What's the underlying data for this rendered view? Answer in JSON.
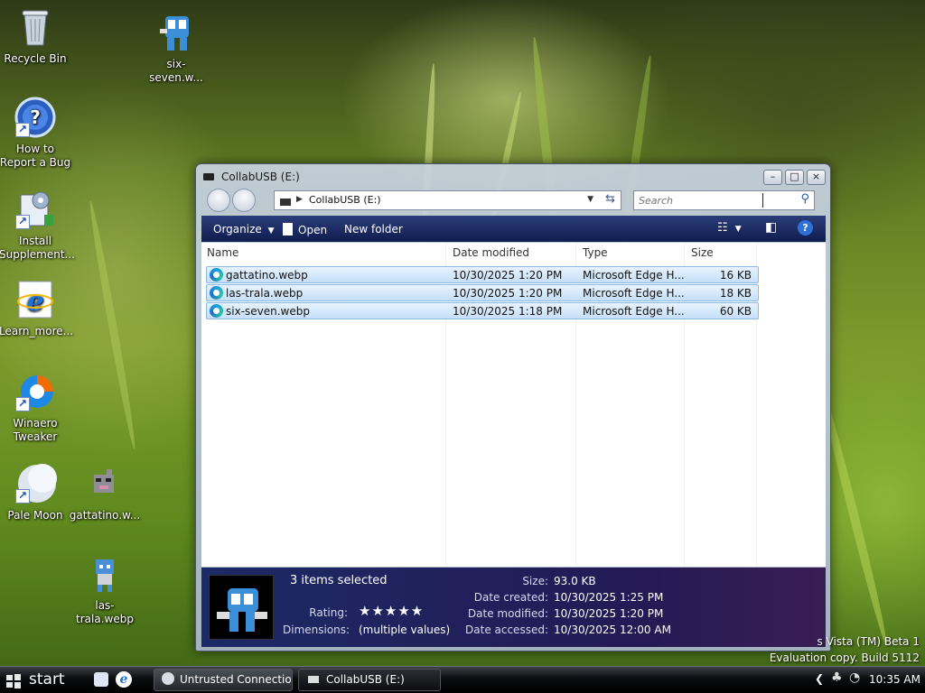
{
  "desktop": {
    "icons": [
      {
        "label": "Recycle Bin"
      },
      {
        "label": "six-seven.w..."
      },
      {
        "label": "How to Report a Bug"
      },
      {
        "label": "Install Supplement..."
      },
      {
        "label": "Learn_more..."
      },
      {
        "label": "Winaero Tweaker"
      },
      {
        "label": "Pale Moon"
      },
      {
        "label": "gattatino.w..."
      },
      {
        "label": "las-trala.webp"
      }
    ],
    "watermark_line1": "s Vista (TM) Beta 1",
    "watermark_line2": "Evaluation copy. Build 5112"
  },
  "window": {
    "title": "CollabUSB (E:)",
    "address_path": "CollabUSB (E:)",
    "search_placeholder": "Search",
    "toolbar": {
      "organize": "Organize",
      "open": "Open",
      "new_folder": "New folder"
    },
    "columns": [
      "Name",
      "Date modified",
      "Type",
      "Size"
    ],
    "files": [
      {
        "name": "gattatino.webp",
        "date": "10/30/2025 1:20 PM",
        "type": "Microsoft Edge H...",
        "size": "16 KB"
      },
      {
        "name": "las-trala.webp",
        "date": "10/30/2025 1:20 PM",
        "type": "Microsoft Edge H...",
        "size": "18 KB"
      },
      {
        "name": "six-seven.webp",
        "date": "10/30/2025 1:18 PM",
        "type": "Microsoft Edge H...",
        "size": "60 KB"
      }
    ],
    "details": {
      "selection": "3 items selected",
      "rating_label": "Rating:",
      "rating_stars": "★★★★★",
      "dimensions_label": "Dimensions:",
      "dimensions_value": "(multiple values)",
      "size_label": "Size:",
      "size_value": "93.0 KB",
      "created_label": "Date created:",
      "created_value": "10/30/2025 1:25 PM",
      "modified_label": "Date modified:",
      "modified_value": "10/30/2025 1:20 PM",
      "accessed_label": "Date accessed:",
      "accessed_value": "10/30/2025 12:00 AM"
    }
  },
  "taskbar": {
    "start_label": "start",
    "tasks": [
      "Untrusted Connectio...",
      "CollabUSB (E:)"
    ],
    "clock": "10:35 AM"
  }
}
